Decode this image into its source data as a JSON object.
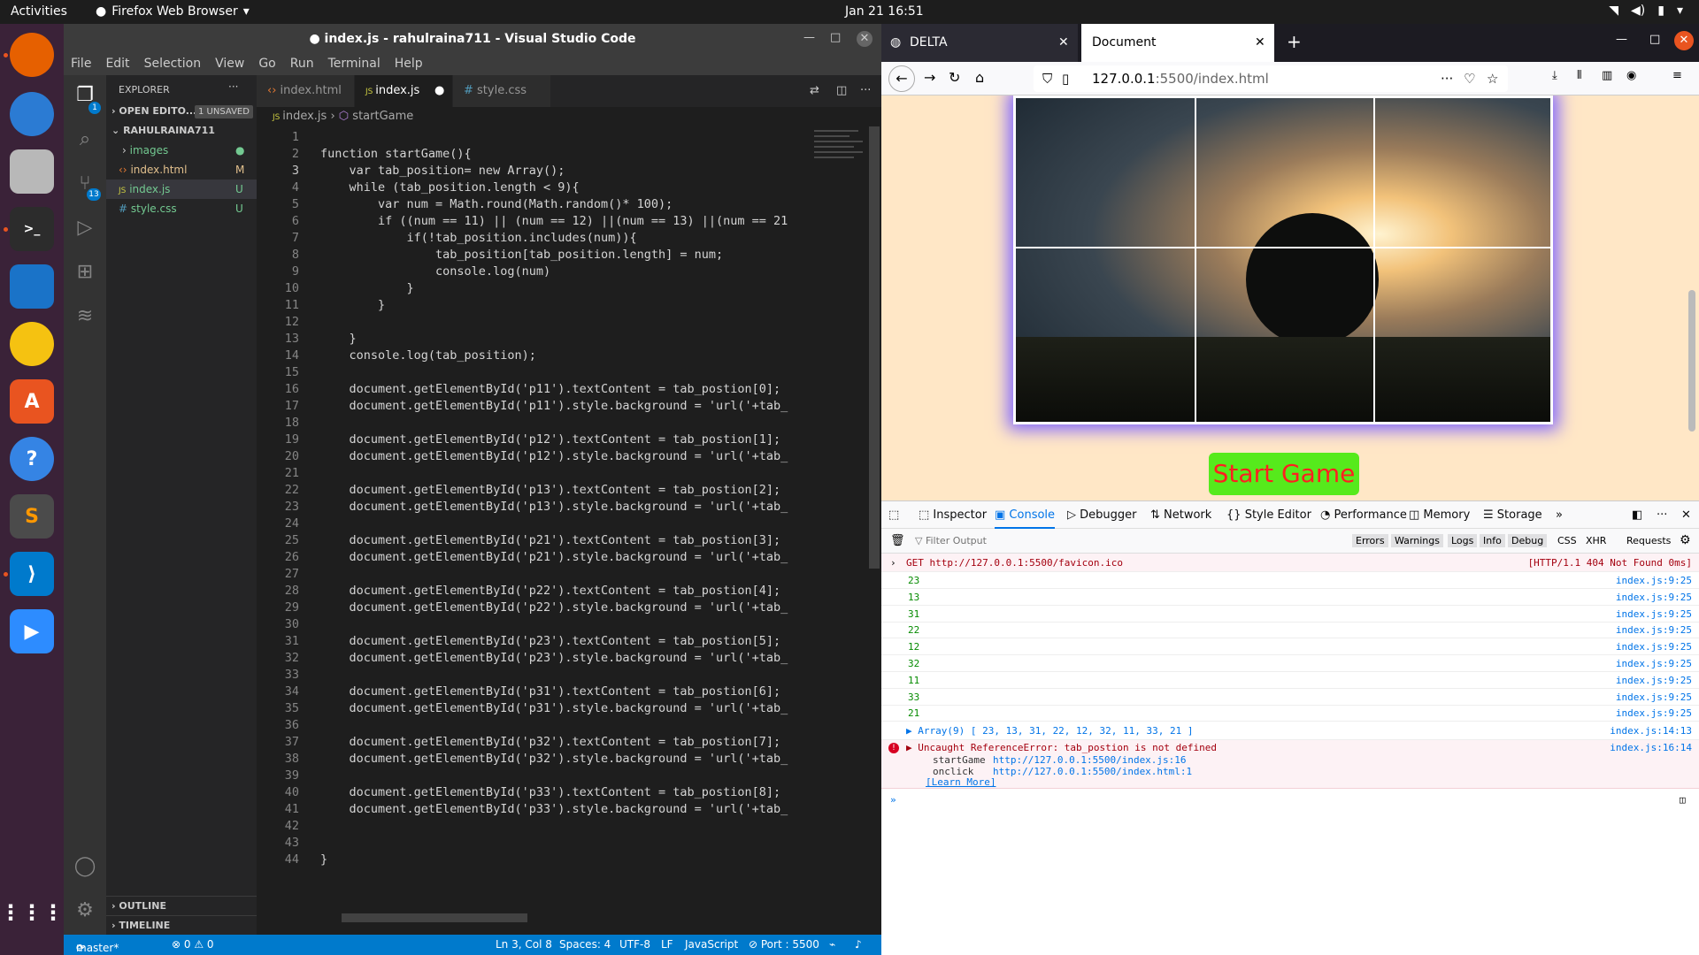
{
  "topbar": {
    "activities": "Activities",
    "app_name": "Firefox Web Browser",
    "clock": "Jan 21  16:51"
  },
  "vscode": {
    "title": "● index.js - rahulraina711 - Visual Studio Code",
    "menu": [
      "File",
      "Edit",
      "Selection",
      "View",
      "Go",
      "Run",
      "Terminal",
      "Help"
    ],
    "explorer": {
      "header": "EXPLORER",
      "open_editors": "OPEN EDITO...",
      "unsaved": "1 UNSAVED",
      "folder": "RAHULRAINA711",
      "files": [
        {
          "name": "images",
          "badge": "",
          "color": "#73c991"
        },
        {
          "name": "index.html",
          "badge": "M",
          "color": "#e2c08d"
        },
        {
          "name": "index.js",
          "badge": "U",
          "color": "#73c991"
        },
        {
          "name": "style.css",
          "badge": "U",
          "color": "#73c991"
        }
      ],
      "outline": "OUTLINE",
      "timeline": "TIMELINE"
    },
    "tabs": [
      {
        "label": "index.html"
      },
      {
        "label": "index.js"
      },
      {
        "label": "style.css"
      }
    ],
    "breadcrumb": {
      "file": "index.js",
      "symbol": "startGame"
    },
    "status": {
      "branch": "master*",
      "problems": "⊗ 0 ⚠ 0",
      "position": "Ln 3, Col 8",
      "spaces": "Spaces: 4",
      "encoding": "UTF-8",
      "eol": "LF",
      "language": "JavaScript",
      "port": "⊘ Port : 5500"
    },
    "scm_badge": "13",
    "explorer_badge": "1",
    "code_lines": [
      "",
      "function startGame(){",
      "    var tab_position= new Array();",
      "    while (tab_position.length < 9){",
      "        var num = Math.round(Math.random()* 100);",
      "        if ((num == 11) || (num == 12) ||(num == 13) ||(num == 21",
      "            if(!tab_position.includes(num)){",
      "                tab_position[tab_position.length] = num;",
      "                console.log(num)",
      "            }",
      "        }",
      "",
      "    }",
      "    console.log(tab_position);",
      "",
      "    document.getElementById('p11').textContent = tab_postion[0];",
      "    document.getElementById('p11').style.background = 'url('+tab_",
      "",
      "    document.getElementById('p12').textContent = tab_postion[1];",
      "    document.getElementById('p12').style.background = 'url('+tab_",
      "",
      "    document.getElementById('p13').textContent = tab_postion[2];",
      "    document.getElementById('p13').style.background = 'url('+tab_",
      "",
      "    document.getElementById('p21').textContent = tab_postion[3];",
      "    document.getElementById('p21').style.background = 'url('+tab_",
      "",
      "    document.getElementById('p22').textContent = tab_postion[4];",
      "    document.getElementById('p22').style.background = 'url('+tab_",
      "",
      "    document.getElementById('p23').textContent = tab_postion[5];",
      "    document.getElementById('p23').style.background = 'url('+tab_",
      "",
      "    document.getElementById('p31').textContent = tab_postion[6];",
      "    document.getElementById('p31').style.background = 'url('+tab_",
      "",
      "    document.getElementById('p32').textContent = tab_postion[7];",
      "    document.getElementById('p32').style.background = 'url('+tab_",
      "",
      "    document.getElementById('p33').textContent = tab_postion[8];",
      "    document.getElementById('p33').style.background = 'url('+tab_",
      "",
      "",
      "}"
    ]
  },
  "firefox": {
    "tabs": [
      {
        "label": "DELTA"
      },
      {
        "label": "Document"
      }
    ],
    "url_host": "127.0.0.1",
    "url_rest": ":5500/index.html",
    "start_button": "Start Game",
    "devtools_tabs": [
      "Inspector",
      "Console",
      "Debugger",
      "Network",
      "Style Editor",
      "Performance",
      "Memory",
      "Storage"
    ],
    "filter_placeholder": "Filter Output",
    "filter_buttons": [
      "Errors",
      "Warnings",
      "Logs",
      "Info",
      "Debug",
      "CSS",
      "XHR",
      "Requests"
    ],
    "console": {
      "get_request": "GET http://127.0.0.1:5500/favicon.ico",
      "get_status": "[HTTP/1.1 404 Not Found 0ms]",
      "logs": [
        {
          "value": "23",
          "src": "index.js:9:25"
        },
        {
          "value": "13",
          "src": "index.js:9:25"
        },
        {
          "value": "31",
          "src": "index.js:9:25"
        },
        {
          "value": "22",
          "src": "index.js:9:25"
        },
        {
          "value": "12",
          "src": "index.js:9:25"
        },
        {
          "value": "32",
          "src": "index.js:9:25"
        },
        {
          "value": "11",
          "src": "index.js:9:25"
        },
        {
          "value": "33",
          "src": "index.js:9:25"
        },
        {
          "value": "21",
          "src": "index.js:9:25"
        }
      ],
      "array_line": "▶ Array(9) [ 23, 13, 31, 22, 12, 32, 11, 33, 21 ]",
      "array_src": "index.js:14:13",
      "error": "▶ Uncaught ReferenceError: tab_postion is not defined",
      "error_src": "index.js:16:14",
      "trace1_fn": "startGame",
      "trace1_url": "http://127.0.0.1:5500/index.js:16",
      "trace2_fn": "onclick",
      "trace2_url": "http://127.0.0.1:5500/index.html:1",
      "learn_more": "[Learn More]"
    }
  }
}
